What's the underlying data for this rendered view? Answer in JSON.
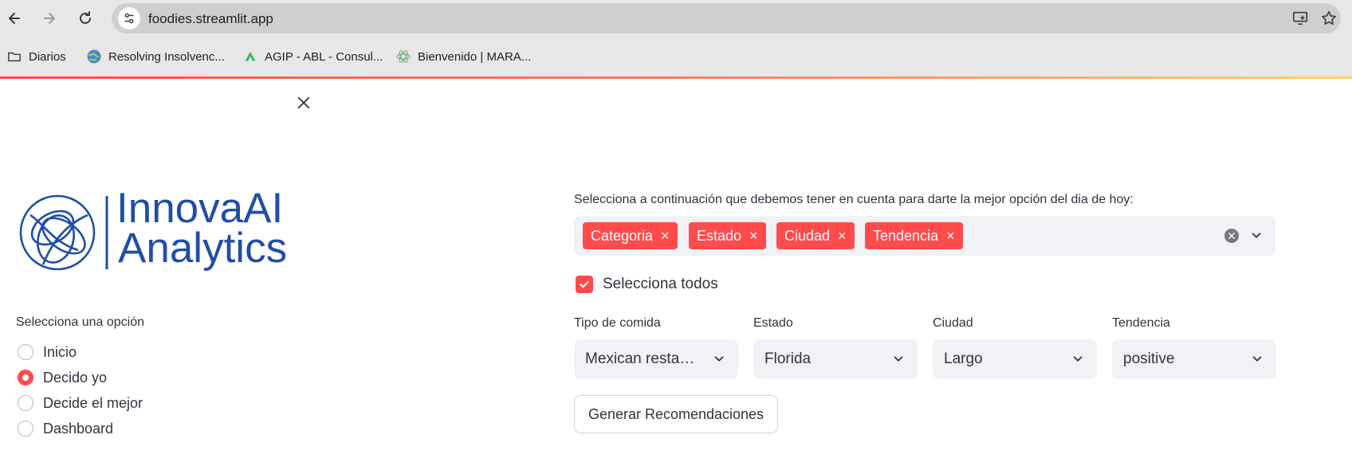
{
  "browser": {
    "url": "foodies.streamlit.app",
    "bookmarks": [
      {
        "label": "Diarios",
        "icon": "folder-icon"
      },
      {
        "label": "Resolving Insolvenc...",
        "icon": "globe-icon"
      },
      {
        "label": "AGIP - ABL - Consul...",
        "icon": "agip-logo-icon"
      },
      {
        "label": "Bienvenido | MARA...",
        "icon": "mara-logo-icon"
      }
    ]
  },
  "sidebar": {
    "logo": {
      "line1": "InnovaAI",
      "line2": "Analytics"
    },
    "radio_label": "Selecciona una opción",
    "options": [
      {
        "label": "Inicio",
        "checked": false
      },
      {
        "label": "Decido yo",
        "checked": true
      },
      {
        "label": "Decide el mejor",
        "checked": false
      },
      {
        "label": "Dashboard",
        "checked": false
      }
    ]
  },
  "main": {
    "prompt": "Selecciona a continuación que debemos tener en cuenta para darte la mejor opción del dia de hoy:",
    "chips": [
      "Categoria",
      "Estado",
      "Ciudad",
      "Tendencia"
    ],
    "chip_remove": "×",
    "select_all_label": "Selecciona todos",
    "select_all_checked": true,
    "filters": [
      {
        "label": "Tipo de comida",
        "value": "Mexican resta…"
      },
      {
        "label": "Estado",
        "value": "Florida"
      },
      {
        "label": "Ciudad",
        "value": "Largo"
      },
      {
        "label": "Tendencia",
        "value": "positive"
      }
    ],
    "generate_button": "Generar Recomendaciones"
  },
  "colors": {
    "accent": "#ff4b4b",
    "input_bg": "#f0f2f6",
    "logo_blue": "#1f4ea8"
  }
}
